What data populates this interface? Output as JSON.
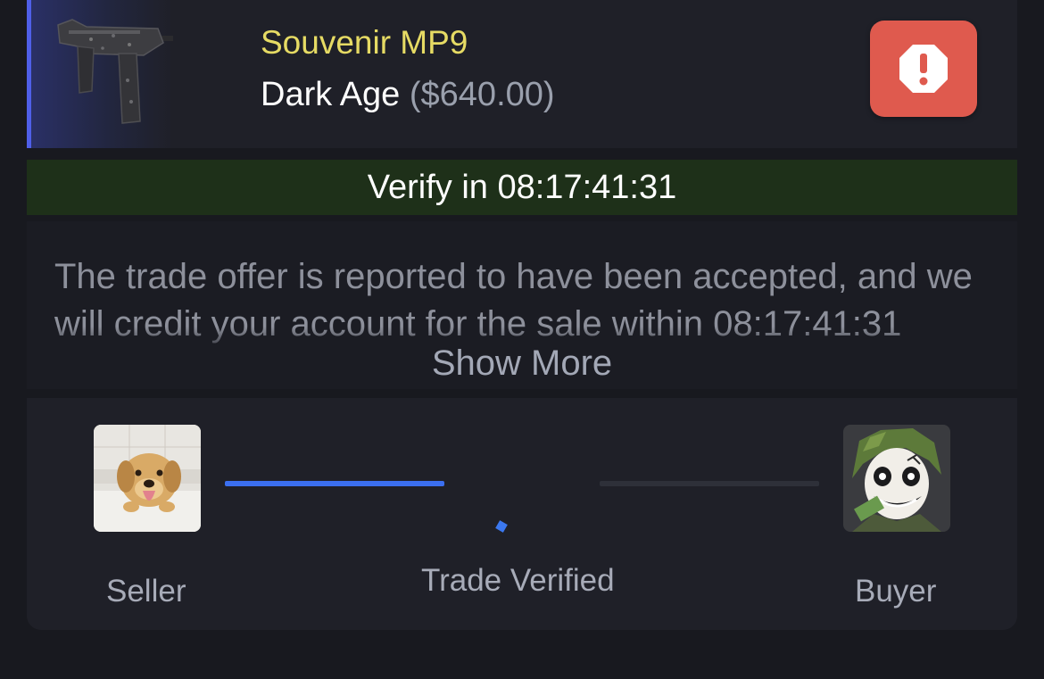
{
  "item": {
    "name": "Souvenir MP9",
    "skin": "Dark Age",
    "price": "($640.00)",
    "image_icon": "smg-icon",
    "accent_color": "#4f5fe8",
    "name_color": "#e6db64"
  },
  "report_button": {
    "icon": "exclamation-octagon-icon",
    "color": "#df5a4e"
  },
  "verify": {
    "text": "Verify in 08:17:41:31",
    "background": "#1e3019"
  },
  "message": {
    "text": "The trade offer is reported to have been accepted, and we will credit your account for the sale within 08:17:41:31",
    "show_more_label": "Show More"
  },
  "trade": {
    "seller_label": "Seller",
    "buyer_label": "Buyer",
    "status_label": "Trade Verified",
    "seller_avatar": "puppy-avatar",
    "buyer_avatar": "joker-avatar",
    "progress_color": "#3b6ff0",
    "seller_to_center_progress": 1.0,
    "center_to_buyer_progress": 0.0
  }
}
